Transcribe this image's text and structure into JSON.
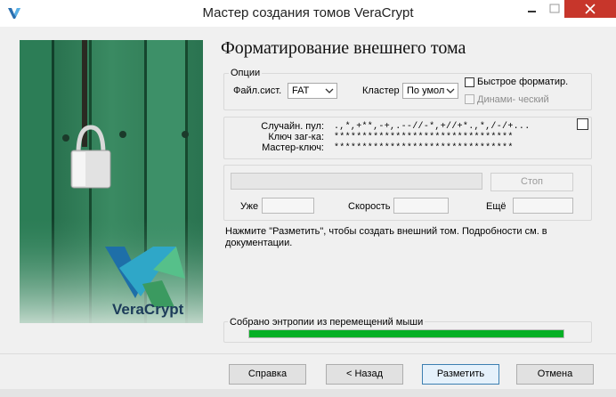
{
  "window": {
    "title": "Мастер создания томов VeraCrypt"
  },
  "page": {
    "heading": "Форматирование внешнего тома",
    "logo_text": "VeraCrypt"
  },
  "options": {
    "legend": "Опции",
    "filesystem_label": "Файл.сист.",
    "filesystem_value": "FAT",
    "cluster_label": "Кластер",
    "cluster_value": "По умол",
    "quick_format_label": "Быстрое форматир.",
    "quick_format_checked": false,
    "dynamic_label": "Динами- ческий",
    "dynamic_checked": false,
    "dynamic_enabled": false
  },
  "random": {
    "pool_label": "Случайн. пул:",
    "pool_value": ".,*,+**,-+,.--//-*,+//+*.,*,/-/+...",
    "header_key_label": "Ключ заг-ка:",
    "header_key_value": "********************************",
    "master_key_label": "Мастер-ключ:",
    "master_key_value": "********************************",
    "show_checked": false
  },
  "progress": {
    "stop_label": "Стоп",
    "done_label": "Уже",
    "speed_label": "Скорость",
    "left_label": "Ещё",
    "done_value": "",
    "speed_value": "",
    "left_value": ""
  },
  "info": {
    "text": "Нажмите \"Разметить\", чтобы создать внешний том. Подробности см. в документации."
  },
  "entropy": {
    "label": "Собрано энтропии из перемещений мыши",
    "fill_fraction": 1.0,
    "bar_color": "#06b025"
  },
  "buttons": {
    "help": "Справка",
    "back": "< Назад",
    "format": "Разметить",
    "cancel": "Отмена"
  },
  "colors": {
    "close_button": "#c7362b",
    "accent": "#3c7fb1"
  }
}
